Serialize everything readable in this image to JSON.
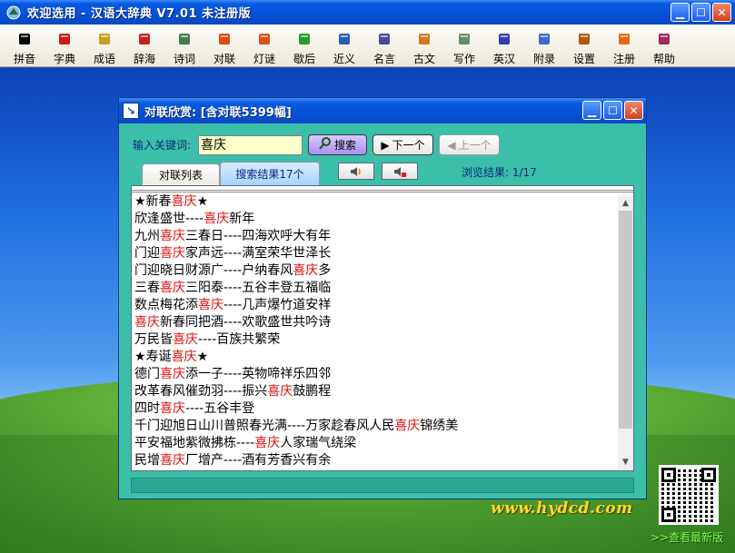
{
  "window": {
    "title": "欢迎选用 - 汉语大辞典 V7.01 未注册版"
  },
  "toolbar": {
    "items": [
      {
        "label": "拼音",
        "icon": "face-icon",
        "color": "#000000"
      },
      {
        "label": "字典",
        "icon": "red-book-icon",
        "color": "#d01818"
      },
      {
        "label": "成语",
        "icon": "books-icon",
        "color": "#c8a020"
      },
      {
        "label": "辞海",
        "icon": "red-books-icon",
        "color": "#c82020"
      },
      {
        "label": "诗词",
        "icon": "scroll-icon",
        "color": "#4a7a4a"
      },
      {
        "label": "对联",
        "icon": "couplet-icon",
        "color": "#e04a10"
      },
      {
        "label": "灯谜",
        "icon": "lantern-icon",
        "color": "#e05010"
      },
      {
        "label": "歇后",
        "icon": "green-book-icon",
        "color": "#2a9a2a"
      },
      {
        "label": "近义",
        "icon": "open-book-icon",
        "color": "#2a5ab8"
      },
      {
        "label": "名言",
        "icon": "notepad-icon",
        "color": "#4a4a9a"
      },
      {
        "label": "古文",
        "icon": "bamboo-icon",
        "color": "#d07a20"
      },
      {
        "label": "写作",
        "icon": "pen-icon",
        "color": "#6a8a6a"
      },
      {
        "label": "英汉",
        "icon": "dictionary-icon",
        "color": "#3a3ab0"
      },
      {
        "label": "附录",
        "icon": "appendix-icon",
        "color": "#3a6ad0"
      },
      {
        "label": "设置",
        "icon": "gear-icon",
        "color": "#b05a10"
      },
      {
        "label": "注册",
        "icon": "register-icon",
        "color": "#e06a10"
      },
      {
        "label": "帮助",
        "icon": "help-book-icon",
        "color": "#a02a5a"
      }
    ]
  },
  "dialog": {
    "title": "对联欣赏: [含对联5399幅]",
    "keyword_label": "输入关键词:",
    "keyword_value": "喜庆",
    "search_label": "搜索",
    "next_label": "下一个",
    "prev_label": "上一个",
    "tabs": [
      "对联列表",
      "搜索结果17个"
    ],
    "browse_result": "浏览结果: 1/17",
    "highlight": "喜庆",
    "results": [
      "★新春喜庆★",
      "欣逢盛世----喜庆新年",
      "九州喜庆三春日----四海欢呼大有年",
      "门迎喜庆家声远----满室荣华世泽长",
      "门迎晓日财源广----户纳春风喜庆多",
      "三春喜庆三阳泰----五谷丰登五福临",
      "数点梅花添喜庆----几声爆竹道安祥",
      "喜庆新春同把酒----欢歌盛世共吟诗",
      "万民皆喜庆----百族共繁荣",
      "★寿诞喜庆★",
      "德门喜庆添一子----英物啼祥乐四邻",
      "改革春风催劲羽----振兴喜庆鼓鹏程",
      "四时喜庆----五谷丰登",
      "千门迎旭日山川普照春光满----万家趁春风人民喜庆锦绣美",
      "平安福地紫微拂栋----喜庆人家瑞气绕梁",
      "民增喜庆厂增产----酒有芳香兴有余"
    ]
  },
  "desktop": {
    "website": "www.hydcd.com",
    "new_version": ">>查看最新版"
  }
}
